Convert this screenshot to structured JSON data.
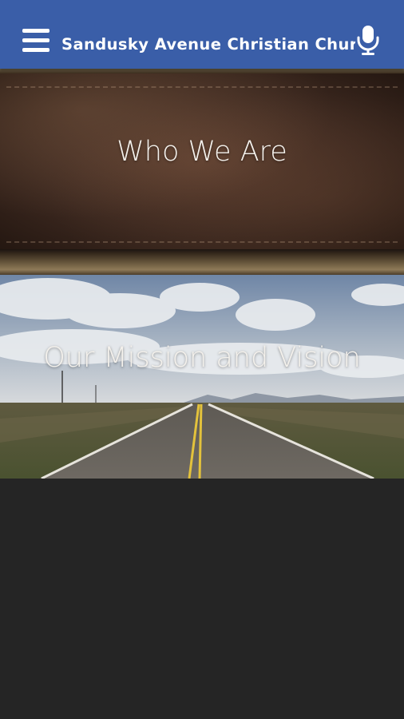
{
  "app_bar": {
    "title": "Sandusky Avenue Christian Church",
    "menu_icon": "hamburger-menu-icon",
    "mic_icon": "microphone-icon",
    "background_color": "#3a5ea8"
  },
  "tiles": [
    {
      "label": "Who We Are",
      "background": "brown-leather-texture"
    },
    {
      "label": "Our Mission and Vision",
      "background": "open-road-under-cloudy-sky"
    }
  ],
  "colors": {
    "page_background": "#252525",
    "tile_text": "#f4f1ec"
  }
}
